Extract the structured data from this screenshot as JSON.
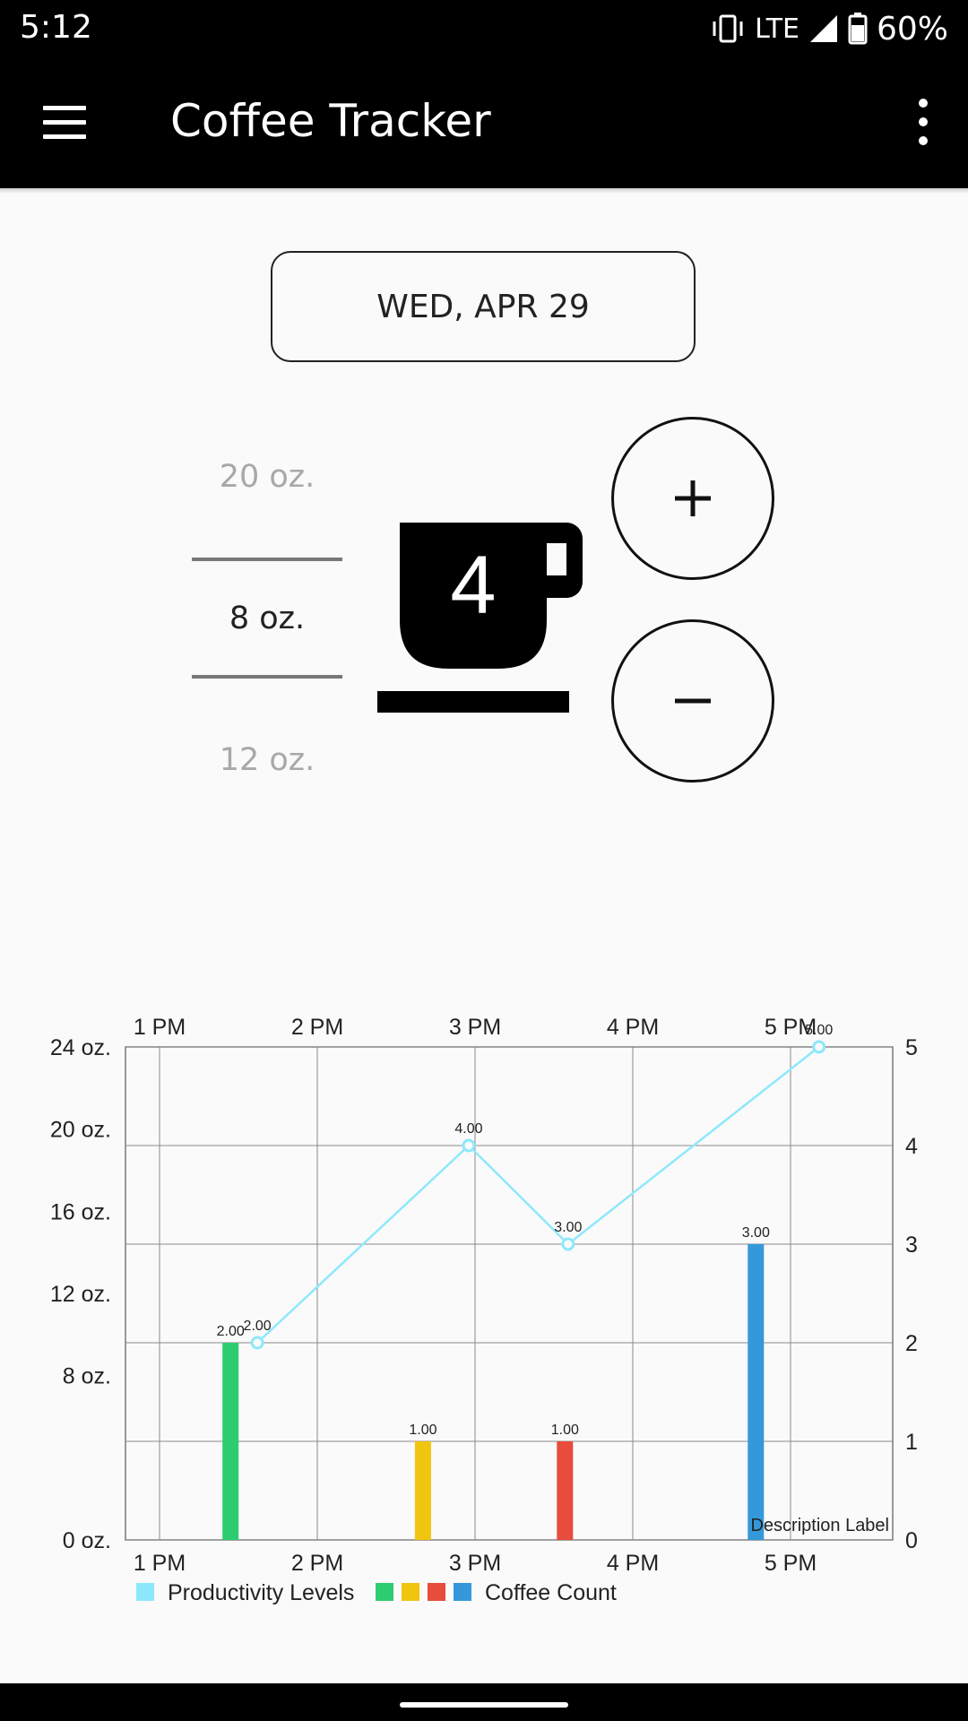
{
  "status": {
    "time": "5:12",
    "network": "LTE",
    "battery": "60%",
    "icons": [
      "vibrate-icon",
      "signal-icon",
      "battery-icon"
    ]
  },
  "app_bar": {
    "title": "Coffee Tracker",
    "menu_icon": "hamburger-menu-icon",
    "overflow_icon": "more-vert-icon"
  },
  "date_button": {
    "label": "WED, APR 29"
  },
  "size_picker": {
    "options": [
      "20 oz.",
      "8 oz.",
      "12 oz."
    ],
    "selected": "8 oz."
  },
  "cup": {
    "count": "4",
    "icon": "coffee-cup-icon"
  },
  "buttons": {
    "increment": "+",
    "decrement": "−"
  },
  "chart_data": {
    "type": "bar+line",
    "categories": [
      "1 PM",
      "2 PM",
      "3 PM",
      "4 PM",
      "5 PM"
    ],
    "x_axis_top_labels": [
      "1 PM",
      "2 PM",
      "3 PM",
      "4 PM",
      "5 PM"
    ],
    "x_axis_bottom_labels": [
      "1 PM",
      "2 PM",
      "3 PM",
      "4 PM",
      "5 PM"
    ],
    "left_axis": {
      "labels": [
        "24 oz.",
        "20 oz.",
        "16 oz.",
        "12 oz.",
        "8 oz.",
        "0 oz."
      ],
      "ticks": [
        24,
        20,
        16,
        12,
        8,
        0
      ],
      "range": [
        0,
        24
      ]
    },
    "right_axis": {
      "labels": [
        "5",
        "4",
        "3",
        "2",
        "1",
        "0"
      ],
      "ticks": [
        5,
        4,
        3,
        2,
        1,
        0
      ],
      "range": [
        0,
        5
      ]
    },
    "grid": true,
    "description_label": "Description Label",
    "bars": {
      "x": [
        1.45,
        2.67,
        3.57,
        4.78
      ],
      "values": [
        2.0,
        1.0,
        1.0,
        3.0
      ],
      "value_labels": [
        "2.00",
        "1.00",
        "1.00",
        "3.00"
      ],
      "colors": [
        "#2ecc71",
        "#f1c40f",
        "#e74c3c",
        "#3498db"
      ],
      "axis": "right"
    },
    "line": {
      "x": [
        1.62,
        2.96,
        3.59,
        5.18
      ],
      "values": [
        2.0,
        4.0,
        3.0,
        5.0
      ],
      "value_labels": [
        "2.00",
        "4.00",
        "3.00",
        "5.00"
      ],
      "color": "#8ee8fb",
      "axis": "right"
    },
    "legend": {
      "placement": "bottom-left",
      "entries": [
        {
          "label": "Productivity Levels",
          "colors": [
            "#8ee8fb"
          ]
        },
        {
          "label": "Coffee Count",
          "colors": [
            "#2ecc71",
            "#f1c40f",
            "#e74c3c",
            "#3498db"
          ]
        }
      ]
    }
  }
}
